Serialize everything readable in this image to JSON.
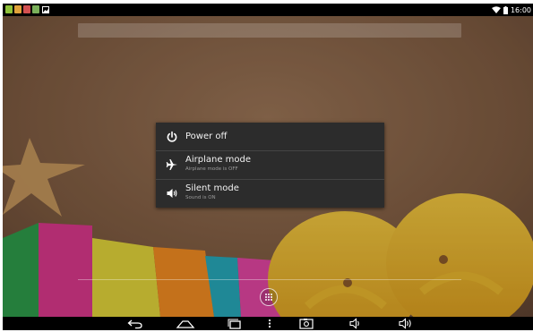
{
  "status_bar": {
    "notifications": [
      "notification-icon",
      "notification-icon",
      "notification-icon",
      "notification-icon",
      "image-icon"
    ],
    "icons": [
      "wifi-icon",
      "battery-icon"
    ],
    "time": "16:00"
  },
  "power_menu": {
    "items": [
      {
        "label": "Power off",
        "sublabel": "",
        "icon": "power-icon"
      },
      {
        "label": "Airplane mode",
        "sublabel": "Airplane mode is OFF",
        "icon": "airplane-icon"
      },
      {
        "label": "Silent mode",
        "sublabel": "Sound is ON",
        "icon": "speaker-icon"
      }
    ]
  },
  "navigation_bar": {
    "buttons": [
      "back-icon",
      "home-icon",
      "recent-apps-icon",
      "menu-icon",
      "screenshot-icon",
      "volume-down-icon",
      "volume-up-icon"
    ]
  },
  "colors": {
    "menu_background": "#2c2c2c",
    "menu_text": "#f2f2f2",
    "menu_subtext": "#9a9a9a",
    "bar_background": "#000000"
  }
}
